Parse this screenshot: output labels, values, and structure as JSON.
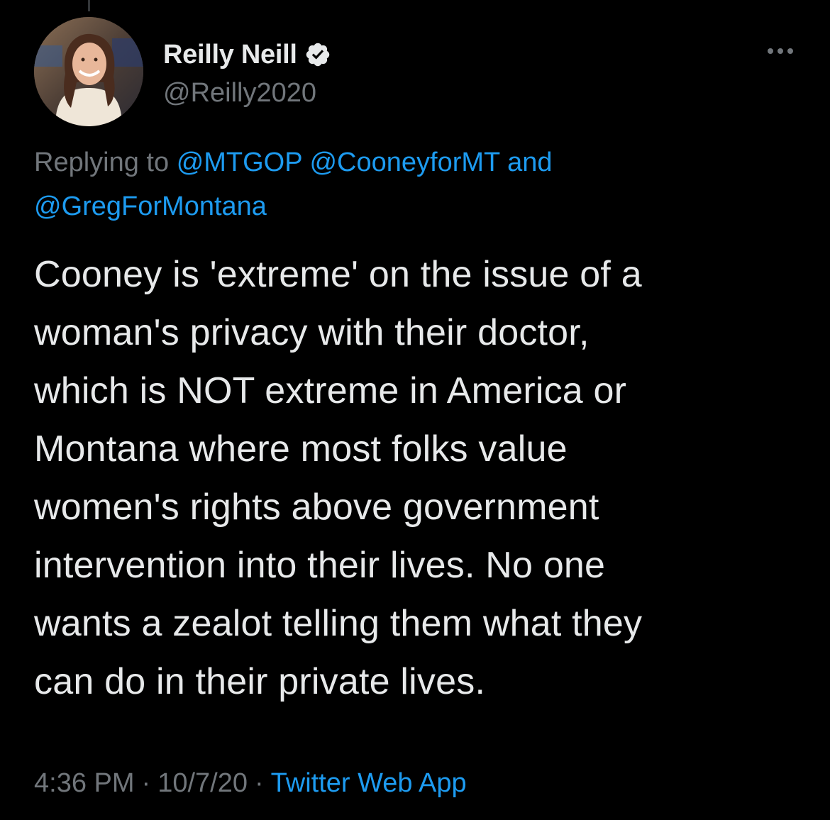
{
  "author": {
    "display_name": "Reilly Neill",
    "handle": "@Reilly2020",
    "verified": true,
    "avatar_icon": "profile-photo",
    "verified_icon": "verified-badge-icon"
  },
  "menu": {
    "icon": "more-icon"
  },
  "reply": {
    "prefix": "Replying to",
    "mentions": [
      "@MTGOP",
      "@CooneyforMT"
    ],
    "conjunction": "and",
    "last_mention": "@GregForMontana"
  },
  "tweet": {
    "lines": [
      "Cooney is 'extreme' on the issue of a",
      "woman's privacy with their doctor,",
      "which is NOT extreme in America or",
      "Montana where most folks value",
      "women's rights above government",
      "intervention into their lives. No one",
      "wants a zealot telling them what they",
      "can do in their private lives."
    ]
  },
  "meta": {
    "time": "4:36 PM",
    "separator": "·",
    "date": "10/7/20",
    "source": "Twitter Web App"
  },
  "colors": {
    "background": "#000000",
    "text": "#e7e9ea",
    "secondary": "#71767b",
    "link": "#1d9bf0"
  }
}
